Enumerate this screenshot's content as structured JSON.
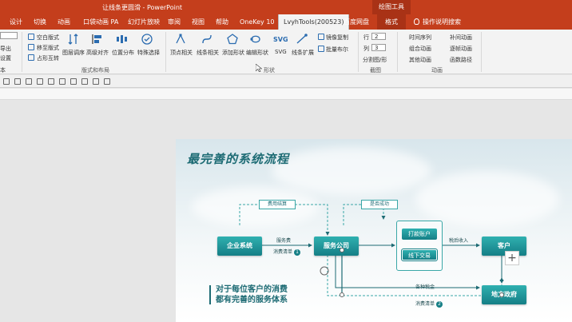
{
  "titlebar": {
    "title": "让线条更圆滑  -  PowerPoint",
    "context_title": "绘图工具"
  },
  "tabs": [
    {
      "label": "设计"
    },
    {
      "label": "切换"
    },
    {
      "label": "动画"
    },
    {
      "label": "口袋动画 PA"
    },
    {
      "label": "幻灯片放映"
    },
    {
      "label": "审阅"
    },
    {
      "label": "视图"
    },
    {
      "label": "帮助"
    },
    {
      "label": "OneKey 10"
    },
    {
      "label": "LvyhTools(200523)"
    },
    {
      "label": "百度网盘"
    },
    {
      "label": "格式"
    },
    {
      "label": "操作说明搜索"
    }
  ],
  "ribbon": {
    "left_items": [
      "导出",
      "设置",
      "本"
    ],
    "layout_checks": [
      "空白版式",
      "移至版式",
      "占形互转"
    ],
    "layout_buttons": [
      "图层调序",
      "高级对齐",
      "位置分布",
      "特殊选择"
    ],
    "layout_group": "版式和布局",
    "shape_buttons": [
      "顶点相关",
      "线条相关",
      "添加形状",
      "编辑形状",
      "SVG",
      "线条扩展"
    ],
    "shape_small": [
      "镜像复制",
      "批量布尔"
    ],
    "shape_group": "形状",
    "crop": {
      "row": "行",
      "col": "列",
      "row_val": "2",
      "col_val": "3",
      "split": "分割图/形"
    },
    "crop_group": "截图",
    "anim_col1": [
      "时间序列",
      "组合动画",
      "其他动画"
    ],
    "anim_col2": [
      "补间动画",
      "逐帧动画",
      "函数路径"
    ],
    "anim_group": "动画"
  },
  "slide": {
    "title": "最完善的系统流程",
    "nodes": {
      "enterprise": "企业系统",
      "service": "服务公司",
      "customer": "客户",
      "gov": "地方政府"
    },
    "mini_nodes": {
      "pay": "打款账户",
      "offline": "线下交易"
    },
    "tags": {
      "fee": "费用结算",
      "success": "是否成功"
    },
    "labels": {
      "service_fee": "服务费",
      "invoice1": "消费清单",
      "invoice1_num": "1",
      "tax_income": "税后收入",
      "taxes": "各种税金",
      "invoice2": "消费清单",
      "invoice2_num": "2"
    },
    "slogan": [
      "对于每位客户的消费",
      "都有完善的服务体系"
    ],
    "plus": "+"
  },
  "colors": {
    "accent": "#c43e1c",
    "teal": "#157f86"
  }
}
